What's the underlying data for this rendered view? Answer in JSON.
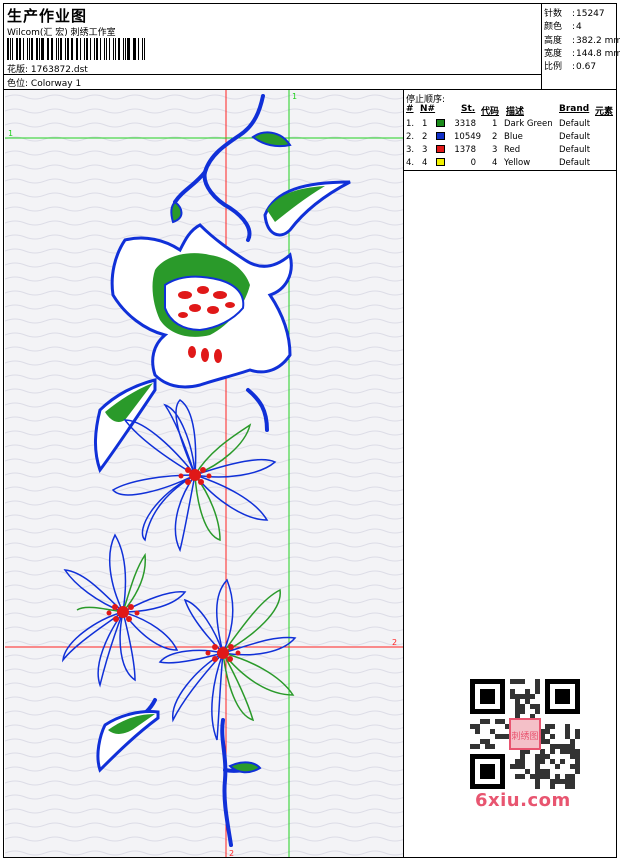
{
  "header": {
    "title": "生产作业图",
    "company": "Wilcom(汇 宏) 刺绣工作室",
    "design_label": "花版:",
    "design_file": "1763872.dst",
    "colorway_label": "色位:",
    "colorway": "Colorway 1"
  },
  "stats": [
    {
      "label": "针数",
      "value": "15247"
    },
    {
      "label": "颜色",
      "value": "4"
    },
    {
      "label": "高度",
      "value": "382.2 mm"
    },
    {
      "label": "宽度",
      "value": "144.8 mm"
    },
    {
      "label": "比例",
      "value": "0.67"
    }
  ],
  "stop_sequence": {
    "title": "停止顺序:",
    "columns": [
      "#",
      "N#",
      "St.",
      "代码",
      "描述",
      "Brand",
      "元素"
    ],
    "rows": [
      {
        "index": "1.",
        "n": "1",
        "color": "#1a8a1a",
        "stitches": "3318",
        "code": "1",
        "desc": "Dark Green",
        "brand": "Default"
      },
      {
        "index": "2.",
        "n": "2",
        "color": "#1030c8",
        "stitches": "10549",
        "code": "2",
        "desc": "Blue",
        "brand": "Default"
      },
      {
        "index": "3.",
        "n": "3",
        "color": "#e01818",
        "stitches": "1378",
        "code": "3",
        "desc": "Red",
        "brand": "Default"
      },
      {
        "index": "4.",
        "n": "4",
        "color": "#f0f000",
        "stitches": "0",
        "code": "4",
        "desc": "Yellow",
        "brand": "Default"
      }
    ]
  },
  "guides": {
    "v1": "1",
    "h1": "1",
    "v2": "2",
    "h2": "2"
  },
  "watermark": {
    "text": "6xiu.com",
    "qr_label": "刺绣图"
  }
}
